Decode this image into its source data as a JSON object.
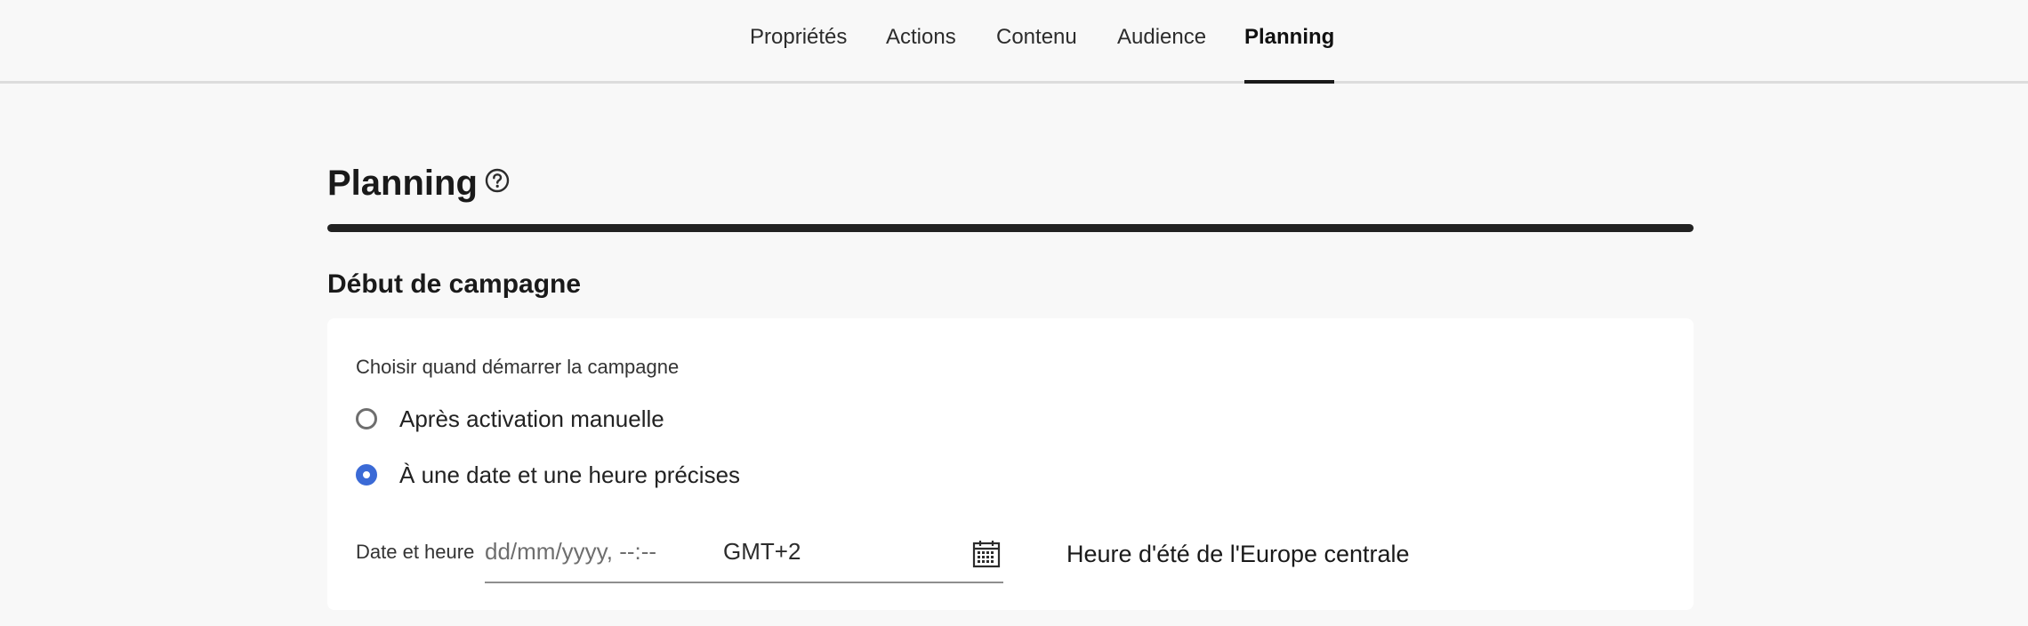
{
  "tabs": {
    "properties": "Propriétés",
    "actions": "Actions",
    "content": "Contenu",
    "audience": "Audience",
    "planning": "Planning"
  },
  "page": {
    "title": "Planning",
    "help_icon": "help-circle-icon"
  },
  "campaign_start": {
    "section_title": "Début de campagne",
    "choose_label": "Choisir quand démarrer la campagne",
    "options": [
      {
        "label": "Après activation manuelle",
        "selected": false
      },
      {
        "label": "À une date et une heure précises",
        "selected": true
      }
    ],
    "datetime": {
      "label": "Date et heure",
      "placeholder": "dd/mm/yyyy,  --:--",
      "timezone_offset": "GMT+2",
      "calendar_icon": "calendar-icon",
      "timezone_name": "Heure d'été de l'Europe centrale"
    }
  },
  "colors": {
    "accent": "#3b6ad6",
    "background": "#f8f8f8",
    "card": "#ffffff",
    "text": "#222222"
  }
}
